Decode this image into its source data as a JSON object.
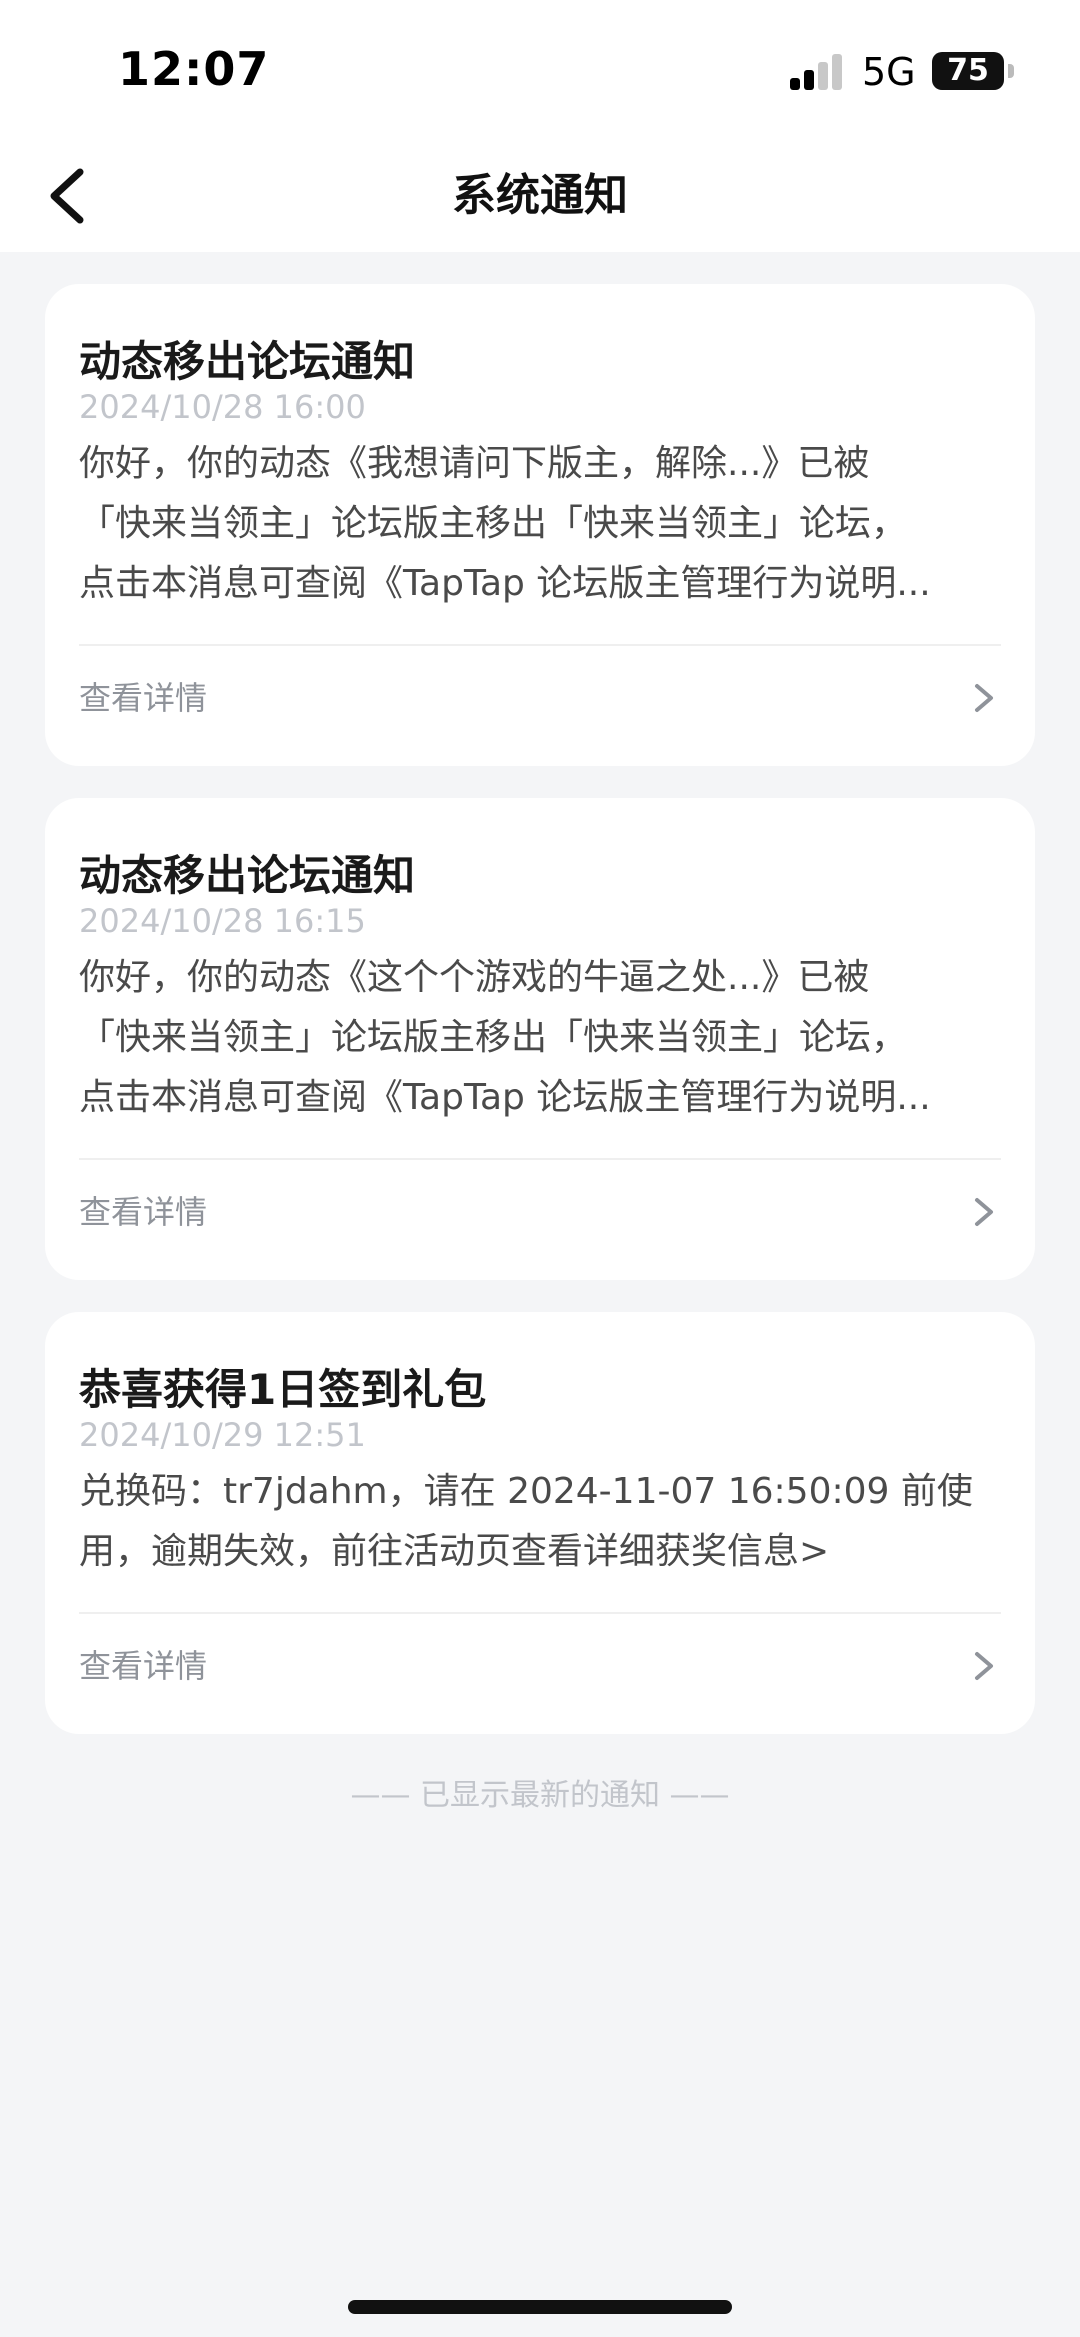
{
  "status_bar": {
    "time": "12:07",
    "network": "5G",
    "battery_level": "75"
  },
  "nav": {
    "title": "系统通知",
    "back_icon": "chevron-left-icon"
  },
  "notifications": [
    {
      "title": "动态移出论坛通知",
      "time": "2024/10/28 16:00",
      "body_lines": [
        "你好，你的动态《我想请问下版主，解除...》已被",
        "「快来当领主」论坛版主移出「快来当领主」论坛，",
        "点击本消息可查阅《TapTap 论坛版主管理行为说明..."
      ],
      "action_label": "查看详情"
    },
    {
      "title": "动态移出论坛通知",
      "time": "2024/10/28 16:15",
      "body_lines": [
        "你好，你的动态《这个个游戏的牛逼之处...》已被",
        "「快来当领主」论坛版主移出「快来当领主」论坛，",
        "点击本消息可查阅《TapTap 论坛版主管理行为说明..."
      ],
      "action_label": "查看详情"
    },
    {
      "title": "恭喜获得1日签到礼包",
      "time": "2024/10/29 12:51",
      "body_lines": [
        "兑换码：tr7jdahm，请在 2024-11-07 16:50:09 前使",
        "用，逾期失效，前往活动页查看详细获奖信息>"
      ],
      "action_label": "查看详情"
    }
  ],
  "end_note": "—— 已显示最新的通知 ——",
  "colors": {
    "background": "#f4f5f7",
    "card": "#ffffff",
    "title": "#1a1a1a",
    "timestamp": "#c2c5cb",
    "body": "#4a4a4a",
    "action": "#8f939a"
  }
}
